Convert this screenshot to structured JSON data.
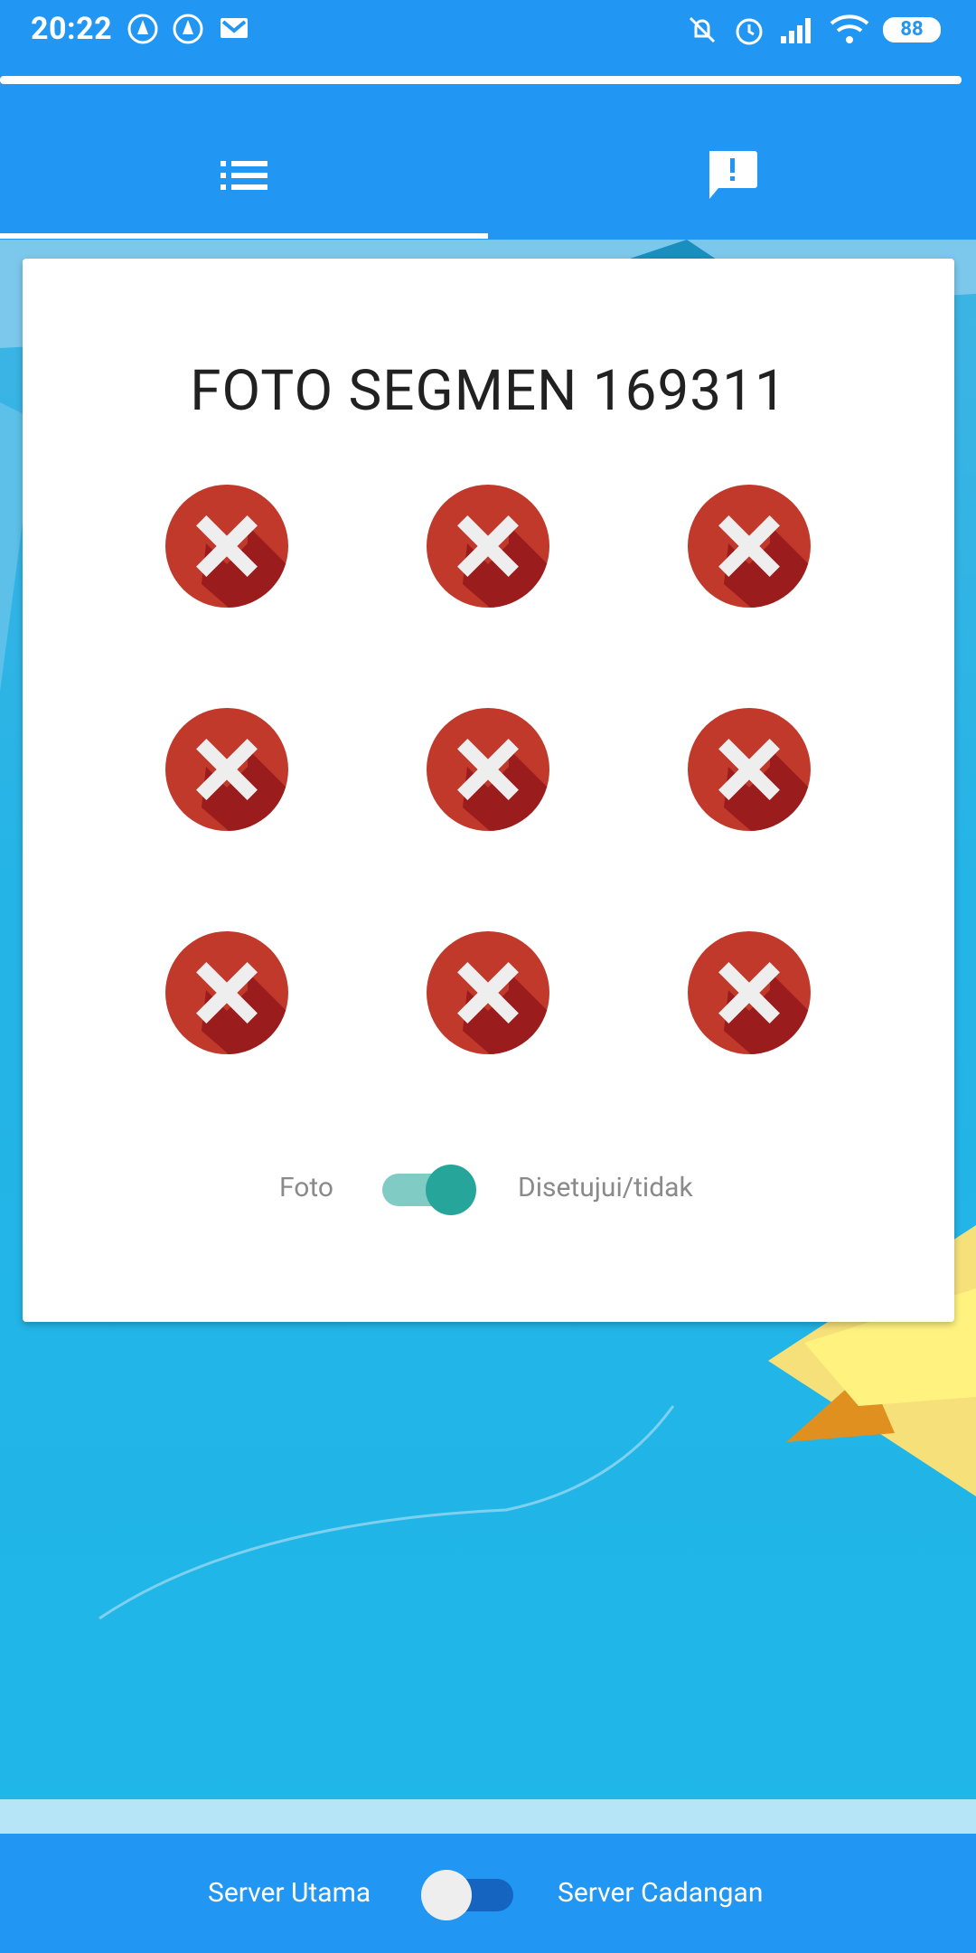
{
  "status_bar": {
    "time": "20:22",
    "battery": "88",
    "icons": [
      "app-notification-icon",
      "app-notification-icon",
      "mail-icon",
      "mute-vibrate-icon",
      "alarm-icon",
      "signal-icon",
      "wifi-icon",
      "battery-icon"
    ]
  },
  "tabs": [
    {
      "icon": "list-icon",
      "selected": true
    },
    {
      "icon": "feedback-icon",
      "selected": false
    }
  ],
  "card": {
    "title": "FOTO SEGMEN 169311",
    "photos": [
      {
        "status": "rejected-icon"
      },
      {
        "status": "rejected-icon"
      },
      {
        "status": "rejected-icon"
      },
      {
        "status": "rejected-icon"
      },
      {
        "status": "rejected-icon"
      },
      {
        "status": "rejected-icon"
      },
      {
        "status": "rejected-icon"
      },
      {
        "status": "rejected-icon"
      },
      {
        "status": "rejected-icon"
      }
    ],
    "toggle": {
      "left_label": "Foto",
      "right_label": "Disetujui/tidak",
      "on": true
    }
  },
  "bottom": {
    "left_label": "Server Utama",
    "right_label": "Server Cadangan",
    "on": false
  },
  "colors": {
    "primary": "#2196f3",
    "toggle_on": "#26a69a",
    "reject_red": "#c0392b"
  }
}
